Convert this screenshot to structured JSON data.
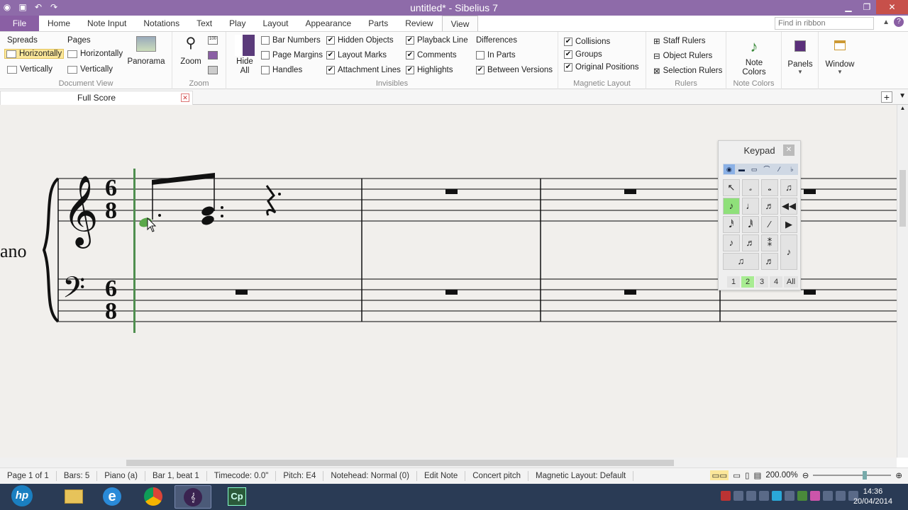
{
  "window": {
    "title": "untitled* - Sibelius 7"
  },
  "tabs": [
    "File",
    "Home",
    "Note Input",
    "Notations",
    "Text",
    "Play",
    "Layout",
    "Appearance",
    "Parts",
    "Review",
    "View"
  ],
  "active_tab": "View",
  "search": {
    "placeholder": "Find in ribbon"
  },
  "ribbon": {
    "document_view": {
      "label": "Document View",
      "spreads": "Spreads",
      "pages": "Pages",
      "spreads_horizontally": "Horizontally",
      "spreads_vertically": "Vertically",
      "pages_horizontally": "Horizontally",
      "pages_vertically": "Vertically",
      "panorama": "Panorama"
    },
    "zoom": {
      "label": "Zoom",
      "zoom_button": "Zoom"
    },
    "invisibles": {
      "label": "Invisibles",
      "hide_all": "Hide All",
      "items": [
        {
          "text": "Bar Numbers",
          "checked": false
        },
        {
          "text": "Page Margins",
          "checked": false
        },
        {
          "text": "Handles",
          "checked": false
        },
        {
          "text": "Hidden Objects",
          "checked": true
        },
        {
          "text": "Layout Marks",
          "checked": true
        },
        {
          "text": "Attachment Lines",
          "checked": true
        },
        {
          "text": "Playback Line",
          "checked": true
        },
        {
          "text": "Comments",
          "checked": true
        },
        {
          "text": "Highlights",
          "checked": true
        },
        {
          "text": "Differences",
          "checked": false
        },
        {
          "text": "In Parts",
          "checked": false
        },
        {
          "text": "Between Versions",
          "checked": true
        }
      ]
    },
    "magnetic_layout": {
      "label": "Magnetic Layout",
      "items": [
        {
          "text": "Collisions",
          "checked": true
        },
        {
          "text": "Groups",
          "checked": true
        },
        {
          "text": "Original Positions",
          "checked": true
        }
      ]
    },
    "rulers": {
      "label": "Rulers",
      "staff": "Staff Rulers",
      "object": "Object Rulers",
      "selection": "Selection Rulers"
    },
    "note_colors": {
      "label": "Note Colors",
      "button": "Note Colors"
    },
    "panels": "Panels",
    "window": "Window"
  },
  "document_tab": {
    "label": "Full Score"
  },
  "score": {
    "instrument": "ano",
    "time_sig_top": "6",
    "time_sig_bottom": "8"
  },
  "keypad": {
    "title": "Keypad",
    "layers": [
      "1",
      "2",
      "3",
      "4",
      "All"
    ],
    "active_layer": "2"
  },
  "status": {
    "page": "Page 1 of 1",
    "bars": "Bars: 5",
    "instrument": "Piano (a)",
    "position": "Bar 1, beat 1",
    "timecode": "Timecode: 0.0\"",
    "pitch": "Pitch: E4",
    "notehead": "Notehead: Normal (0)",
    "mode": "Edit Note",
    "concert": "Concert pitch",
    "magnetic": "Magnetic Layout: Default",
    "zoom": "200.00%"
  },
  "clock": {
    "time": "14:36",
    "date": "20/04/2014"
  },
  "colors": {
    "accent": "#8a5fa4",
    "highlight_green": "#5ba84a",
    "playback_line": "#4f8f4f"
  }
}
